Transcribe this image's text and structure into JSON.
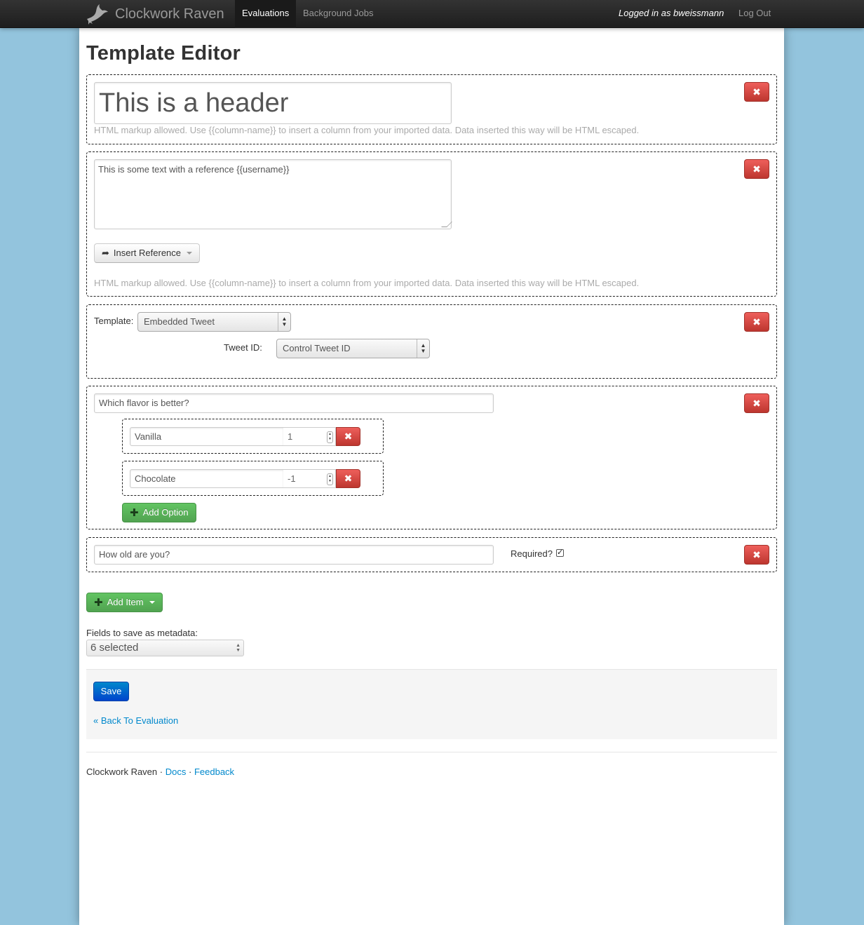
{
  "nav": {
    "brand": "Clockwork Raven",
    "links": [
      {
        "label": "Evaluations",
        "active": true
      },
      {
        "label": "Background Jobs",
        "active": false
      }
    ],
    "user_text": "Logged in as bweissmann",
    "logout": "Log Out"
  },
  "page_title": "Template Editor",
  "help_text": "HTML markup allowed. Use {{column-name}} to insert a column from your imported data. Data inserted this way will be HTML escaped.",
  "header_item": {
    "value": "This is a header"
  },
  "text_item": {
    "value": "This is some text with a reference {{username}}",
    "insert_reference_label": "Insert Reference"
  },
  "template_item": {
    "template_label": "Template:",
    "template_value": "Embedded Tweet",
    "tweet_id_label": "Tweet ID:",
    "tweet_id_value": "Control Tweet ID"
  },
  "mc_item": {
    "question": "Which flavor is better?",
    "options": [
      {
        "label": "Vanilla",
        "value": "1"
      },
      {
        "label": "Chocolate",
        "value": "-1"
      }
    ],
    "add_option_label": "Add Option"
  },
  "fr_item": {
    "question": "How old are you?",
    "required_label": "Required?",
    "required_checked": true
  },
  "add_item_label": "Add Item",
  "metadata": {
    "label": "Fields to save as metadata:",
    "value": "6 selected"
  },
  "actions": {
    "save_label": "Save",
    "back_label": "« Back To Evaluation"
  },
  "footer": {
    "brand": "Clockwork Raven",
    "sep": "·",
    "docs": "Docs",
    "feedback": "Feedback"
  },
  "icons": {
    "delete": "x-icon",
    "share": "share-icon",
    "plus": "plus-icon"
  },
  "colors": {
    "danger": "#da4f49",
    "success": "#5bb75b",
    "primary": "#006dcc",
    "background": "#93c4dd"
  }
}
